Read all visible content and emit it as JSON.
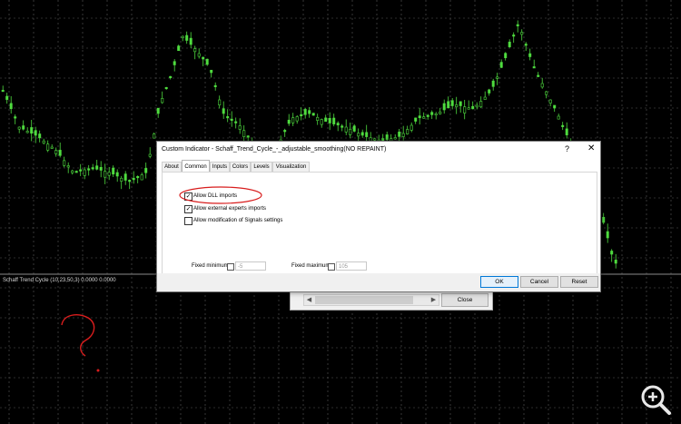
{
  "chart": {
    "subtitle": "Schaff Trend Cycle (10,23,50,3) 0.0000 0.0000"
  },
  "dialog": {
    "title": "Custom Indicator - Schaff_Trend_Cycle_-_adjustable_smoothing(NO REPAINT)",
    "help_symbol": "?",
    "close_symbol": "✕",
    "tabs": [
      "About",
      "Common",
      "Inputs",
      "Colors",
      "Levels",
      "Visualization"
    ],
    "active_tab": "Common",
    "checkboxes": [
      {
        "label": "Allow DLL imports",
        "checked": true
      },
      {
        "label": "Allow external experts imports",
        "checked": true
      },
      {
        "label": "Allow modification of Signals settings",
        "checked": false
      }
    ],
    "fixed_minimum": {
      "label": "Fixed minimum",
      "value": "-5",
      "checked": false
    },
    "fixed_maximum": {
      "label": "Fixed maximum",
      "value": "105",
      "checked": false
    },
    "buttons": {
      "ok": "OK",
      "cancel": "Cancel",
      "reset": "Reset"
    }
  },
  "back_dialog": {
    "close_label": "Close"
  },
  "colors": {
    "background": "#000000",
    "candle": "#4fdc3f",
    "annotation": "#d81d1d"
  }
}
